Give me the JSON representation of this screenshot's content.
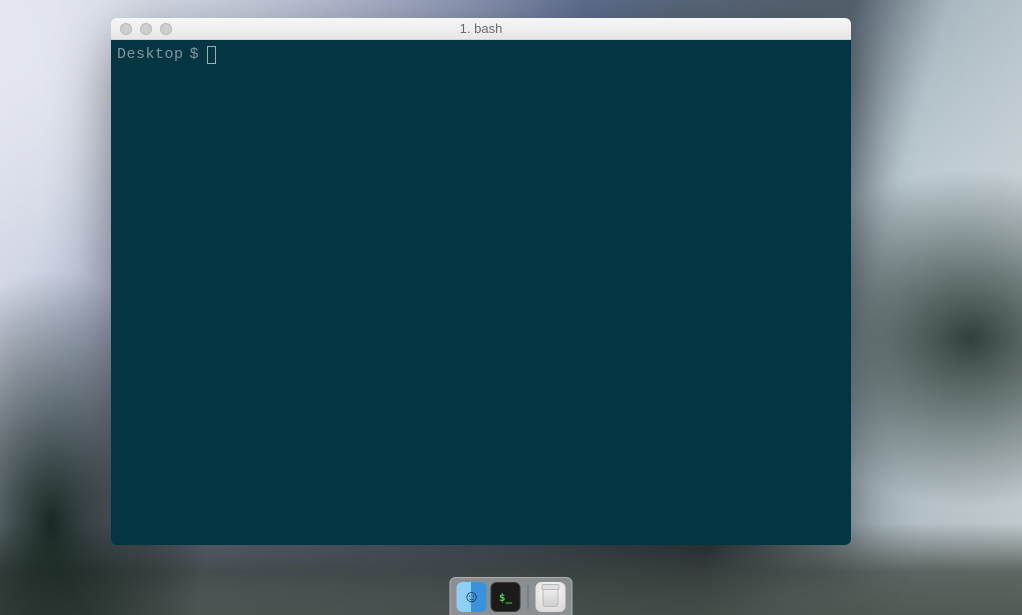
{
  "window": {
    "title": "1. bash"
  },
  "terminal": {
    "prompt_cwd": "Desktop",
    "prompt_symbol": "$",
    "command_input": ""
  },
  "dock": {
    "items": [
      {
        "name": "Finder"
      },
      {
        "name": "Terminal"
      },
      {
        "name": "Trash"
      }
    ]
  }
}
